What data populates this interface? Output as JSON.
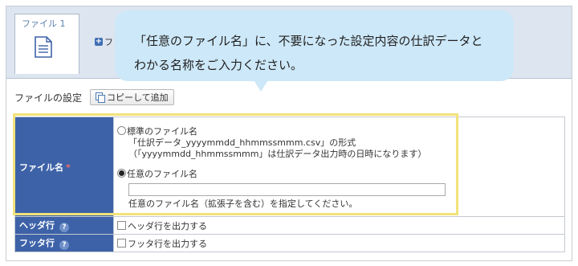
{
  "tab": {
    "label": "ファイル 1",
    "icon": "document-icon"
  },
  "add_button": {
    "label": "フ",
    "icon": "plus-icon"
  },
  "settings": {
    "label": "ファイルの設定",
    "copy_button": "コピーして追加"
  },
  "table": {
    "filename": {
      "header": "ファイル名",
      "required": "*",
      "standard_option": "標準のファイル名",
      "standard_format": "「仕訳データ_yyyymmdd_hhmmssmmm.csv」の形式",
      "standard_note": "（「yyyymmdd_hhmmssmmm」は仕訳データ出力時の日時になります）",
      "custom_option": "任意のファイル名",
      "custom_value": "",
      "custom_hint": "任意のファイル名（拡張子を含む）を指定してください。"
    },
    "header_row": {
      "header": "ヘッダ行",
      "checkbox_label": "ヘッダ行を出力する"
    },
    "footer_row": {
      "header": "フッタ行",
      "checkbox_label": "フッタ行を出力する"
    }
  },
  "callout": {
    "line1": "「任意のファイル名」に、不要になった設定内容の仕訳データと",
    "line2": "わかる名称をご入力ください。"
  },
  "colors": {
    "header_bg": "#3d62a8",
    "callout_bg": "#cde8f8",
    "highlight": "#f2e27a",
    "required": "#f06a6a"
  }
}
